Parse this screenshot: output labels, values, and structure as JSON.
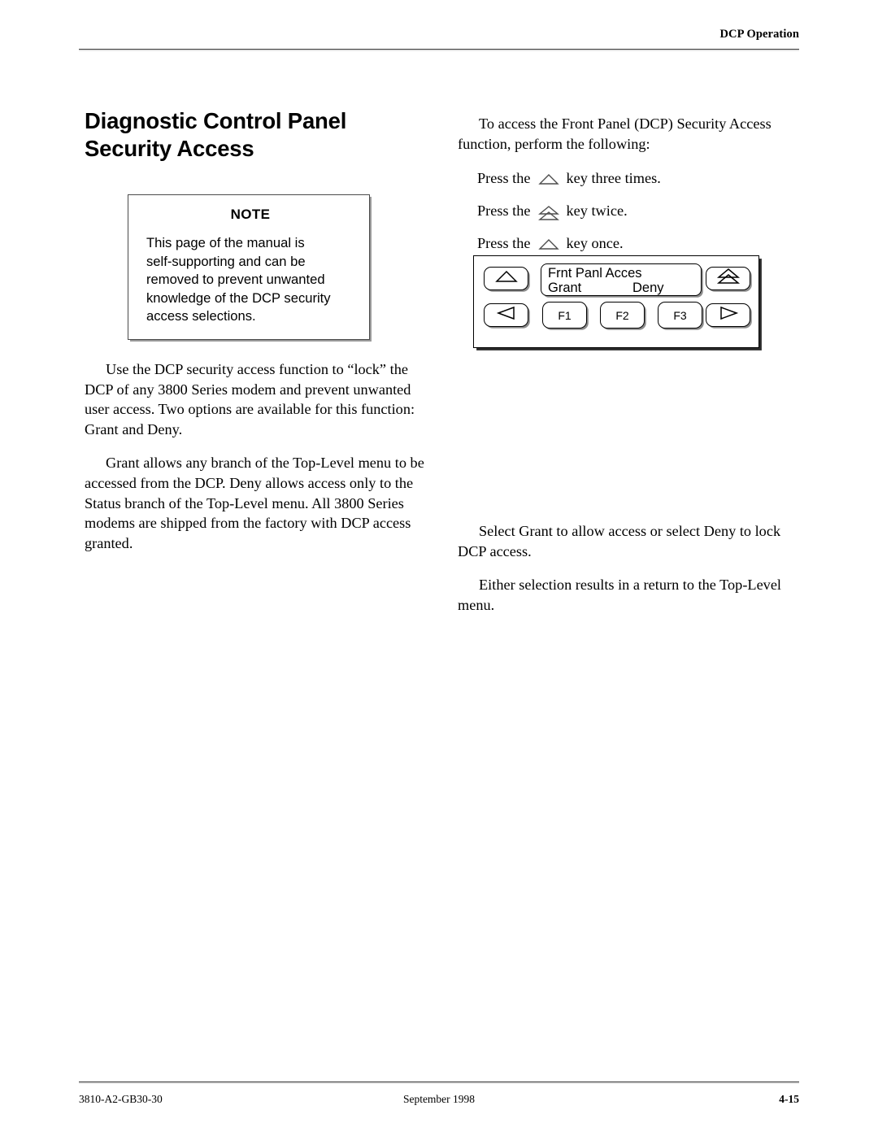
{
  "header": {
    "title": "DCP Operation"
  },
  "footer": {
    "doc_number": "3810-A2-GB30-30",
    "date": "September 1998",
    "page_number": "4-15"
  },
  "left_column": {
    "section_title": {
      "line1": "Diagnostic Control Panel",
      "line2": "Security Access"
    },
    "note": {
      "label": "NOTE",
      "lines": [
        "This page of the manual is",
        "self-supporting and can be",
        "removed to prevent unwanted",
        "knowledge of the DCP security",
        "access selections."
      ]
    },
    "paragraphs": [
      {
        "lines": [
          "Use the DCP security access function to “lock” the",
          "DCP of any 3800 Series modem and prevent unwanted",
          "user access. Two options are available for this function:",
          "Grant and Deny."
        ]
      },
      {
        "lines": [
          "Grant allows any branch of the Top-Level menu to be",
          "accessed from the DCP. Deny allows access only to the",
          "Status branch of the Top-Level menu. All 3800 Series",
          "modems are shipped from the factory with DCP access",
          "granted."
        ]
      }
    ]
  },
  "right_column": {
    "intro": {
      "lines": [
        "To access the Front Panel (DCP) Security Access",
        "function, perform the following:"
      ]
    },
    "steps": [
      {
        "prefix": "Press the",
        "icon": "up-triangle-key-icon",
        "suffix": "key three times."
      },
      {
        "prefix": "Press the",
        "icon": "double-up-triangle-key-icon",
        "suffix": "key twice."
      },
      {
        "prefix": "Press the",
        "icon": "up-triangle-key-icon",
        "suffix": "key once."
      }
    ],
    "dcp_panel": {
      "lcd_line1": "Frnt Panl Acces",
      "lcd_option_grant": "Grant",
      "lcd_option_deny": "Deny",
      "keys": {
        "up": "",
        "double_up": "",
        "left": "",
        "right": "",
        "f1": "F1",
        "f2": "F2",
        "f3": "F3"
      }
    },
    "closing_paragraphs": [
      {
        "lines": [
          "Select Grant to allow access or select Deny to lock",
          "DCP access."
        ]
      },
      {
        "lines": [
          "Either selection results in a return to the Top-Level",
          "menu."
        ]
      }
    ]
  },
  "colors": {
    "text": "#000000",
    "rule": "#3a3a3a",
    "shadow": "#8c8c8c",
    "page_background": "#ffffff"
  }
}
